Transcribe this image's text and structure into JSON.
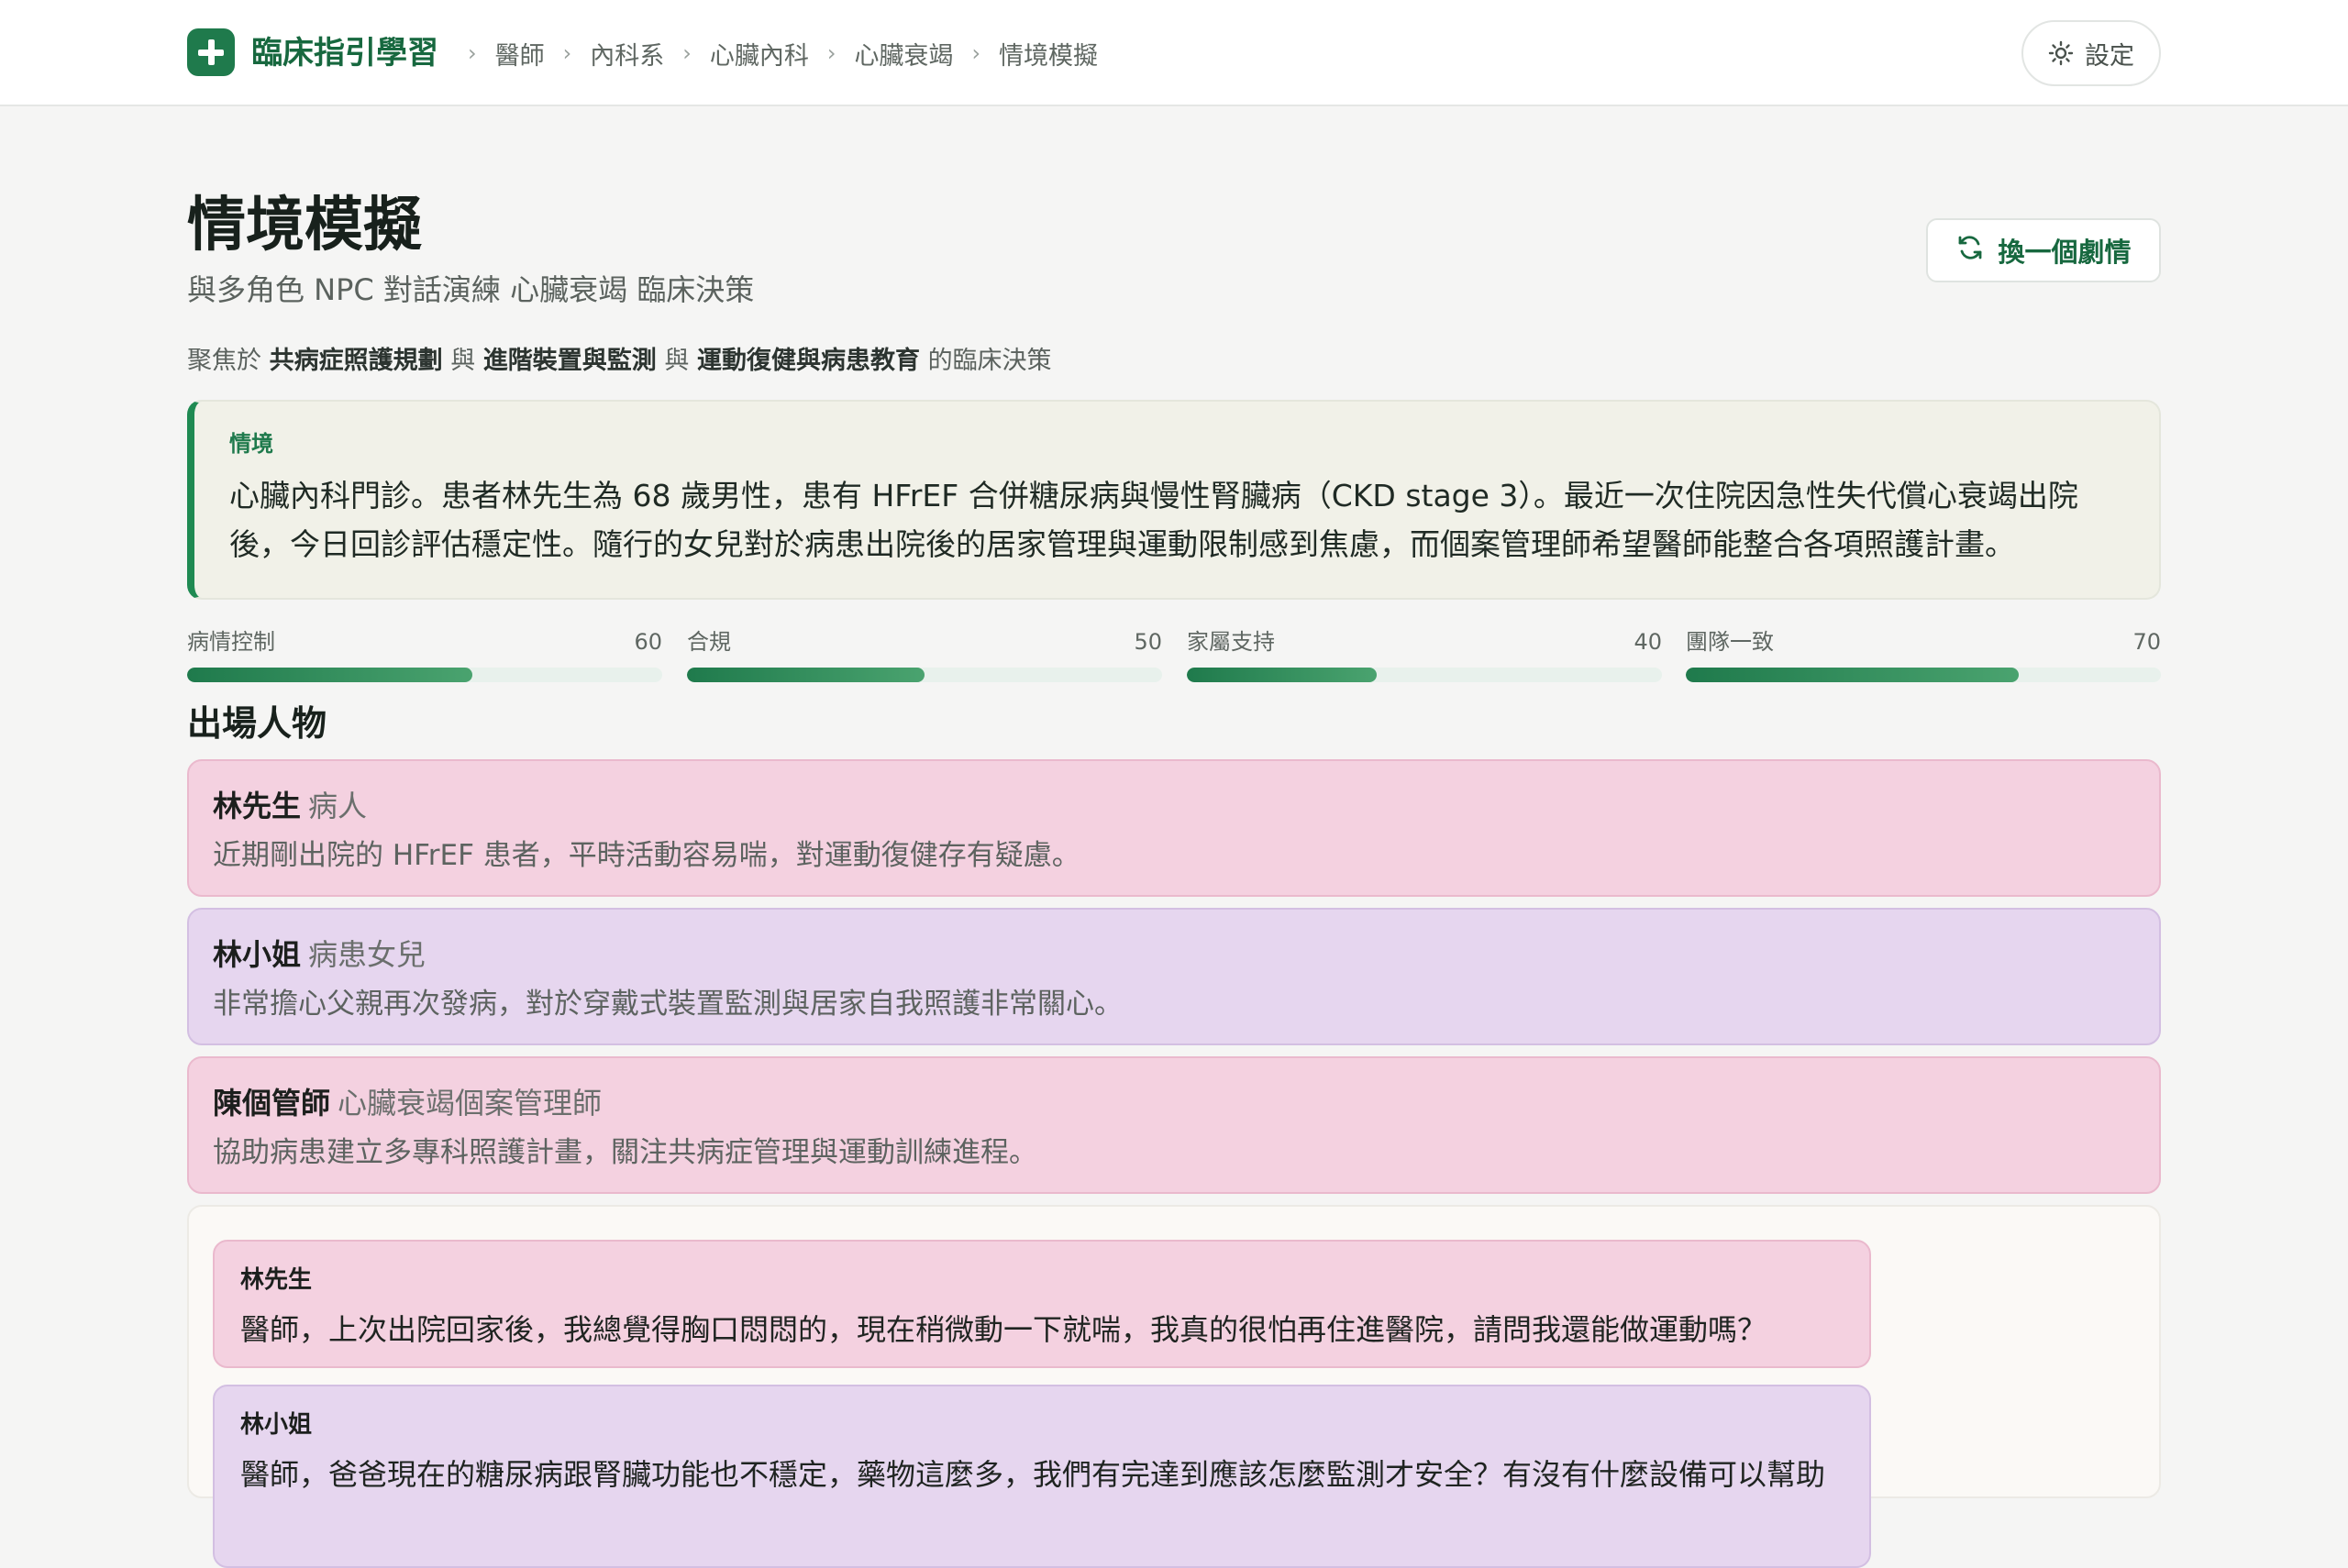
{
  "header": {
    "brand": "臨床指引學習",
    "breadcrumbs": [
      "醫師",
      "內科系",
      "心臟內科",
      "心臟衰竭",
      "情境模擬"
    ],
    "settings_label": "設定"
  },
  "page": {
    "title": "情境模擬",
    "subtitle": "與多角色 NPC 對話演練 心臟衰竭 臨床決策",
    "switch_button": "換一個劇情",
    "focus": {
      "prefix": "聚焦於",
      "topic1": "共病症照護規劃",
      "joiner1": "與",
      "topic2": "進階裝置與監測",
      "joiner2": "與",
      "topic3": "運動復健與病患教育",
      "suffix": "的臨床決策"
    }
  },
  "scenario": {
    "label": "情境",
    "text": "心臟內科門診。患者林先生為 68 歲男性，患有 HFrEF 合併糖尿病與慢性腎臟病（CKD stage 3）。最近一次住院因急性失代償心衰竭出院後，今日回診評估穩定性。隨行的女兒對於病患出院後的居家管理與運動限制感到焦慮，而個案管理師希望醫師能整合各項照護計畫。"
  },
  "meters": [
    {
      "label": "病情控制",
      "value": 60
    },
    {
      "label": "合規",
      "value": 50
    },
    {
      "label": "家屬支持",
      "value": 40
    },
    {
      "label": "團隊一致",
      "value": 70
    }
  ],
  "characters_title": "出場人物",
  "characters": [
    {
      "name": "林先生",
      "role": "病人",
      "desc": "近期剛出院的 HFrEF 患者，平時活動容易喘，對運動復健存有疑慮。",
      "color": "pink"
    },
    {
      "name": "林小姐",
      "role": "病患女兒",
      "desc": "非常擔心父親再次發病，對於穿戴式裝置監測與居家自我照護非常關心。",
      "color": "purple"
    },
    {
      "name": "陳個管師",
      "role": "心臟衰竭個案管理師",
      "desc": "協助病患建立多專科照護計畫，關注共病症管理與運動訓練進程。",
      "color": "pink"
    }
  ],
  "messages": [
    {
      "speaker": "林先生",
      "text": "醫師，上次出院回家後，我總覺得胸口悶悶的，現在稍微動一下就喘，我真的很怕再住進醫院，請問我還能做運動嗎？"
    },
    {
      "speaker": "林小姐",
      "text": "醫師，爸爸現在的糖尿病跟腎臟功能也不穩定，藥物這麼多，我們有完達到應該怎麼監測才安全？有沒有什麼設備可以幫助"
    }
  ],
  "colors": {
    "accent": "#1f7a4c",
    "pink_card": "#f4d1e0",
    "purple_card": "#e6d6ef",
    "scenario_bg": "#f1f1e8"
  },
  "icons": {
    "brand": "plus-cross-icon",
    "settings": "sun-gear-icon",
    "switch": "refresh-icon",
    "breadcrumb_separator": "chevron-right-icon"
  }
}
